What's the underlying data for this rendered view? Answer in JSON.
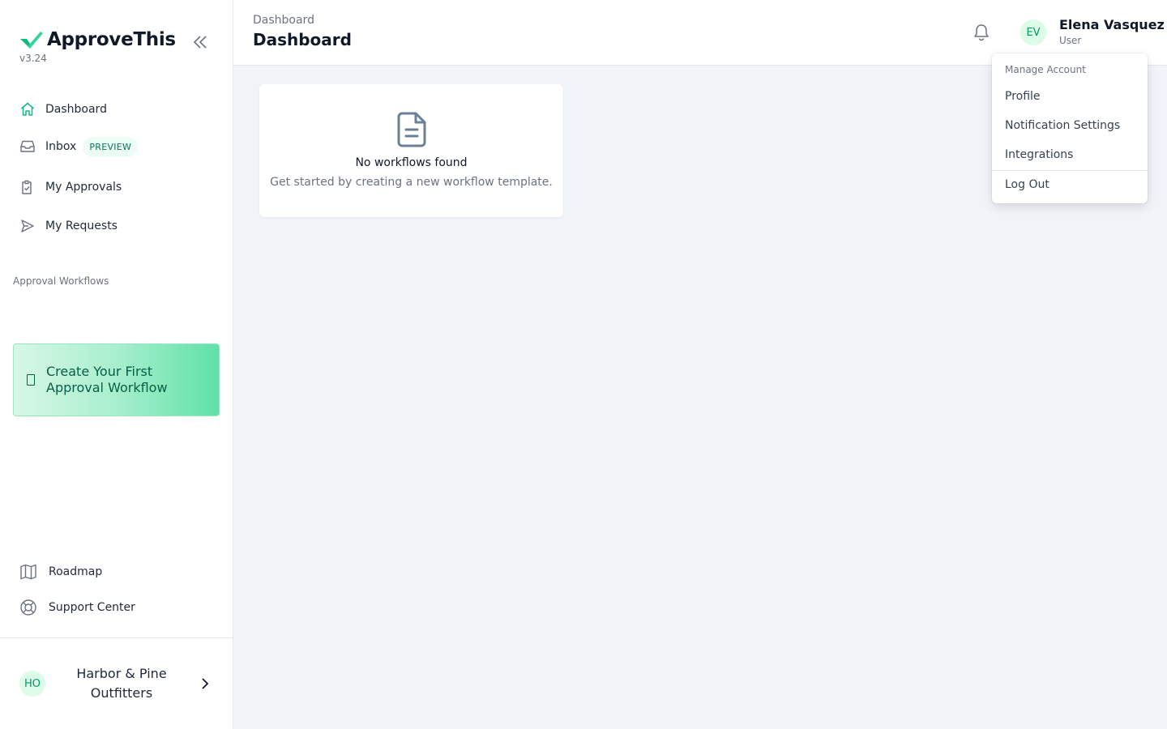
{
  "app": {
    "brand_name": "ApproveThis",
    "version": "v3.24"
  },
  "sidebar": {
    "nav": [
      {
        "label": "Dashboard",
        "icon": "home-icon",
        "active": true
      },
      {
        "label": "Inbox",
        "icon": "inbox-icon",
        "badge": "PREVIEW"
      },
      {
        "label": "My Approvals",
        "icon": "clipboard-check-icon"
      },
      {
        "label": "My Requests",
        "icon": "paper-plane-icon"
      }
    ],
    "section_title": "Approval Workflows",
    "create_cta": "Create Your First Approval Workflow",
    "bottom_links": [
      {
        "label": "Roadmap",
        "icon": "map-icon"
      },
      {
        "label": "Support Center",
        "icon": "lifebuoy-icon"
      }
    ],
    "org": {
      "initials": "HO",
      "name": "Harbor & Pine Outfitters"
    }
  },
  "header": {
    "breadcrumb": "Dashboard",
    "title": "Dashboard",
    "user": {
      "initials": "EV",
      "name": "Elena Vasquez",
      "role": "User"
    }
  },
  "empty_state": {
    "title": "No workflows found",
    "subtitle": "Get started by creating a new workflow template."
  },
  "account_menu": {
    "header": "Manage Account",
    "items": [
      "Profile",
      "Notification Settings",
      "Integrations"
    ],
    "logout": "Log Out"
  },
  "colors": {
    "brand": "#34d399",
    "accent_dark": "#065f46",
    "page_bg": "#f0f3f7"
  }
}
